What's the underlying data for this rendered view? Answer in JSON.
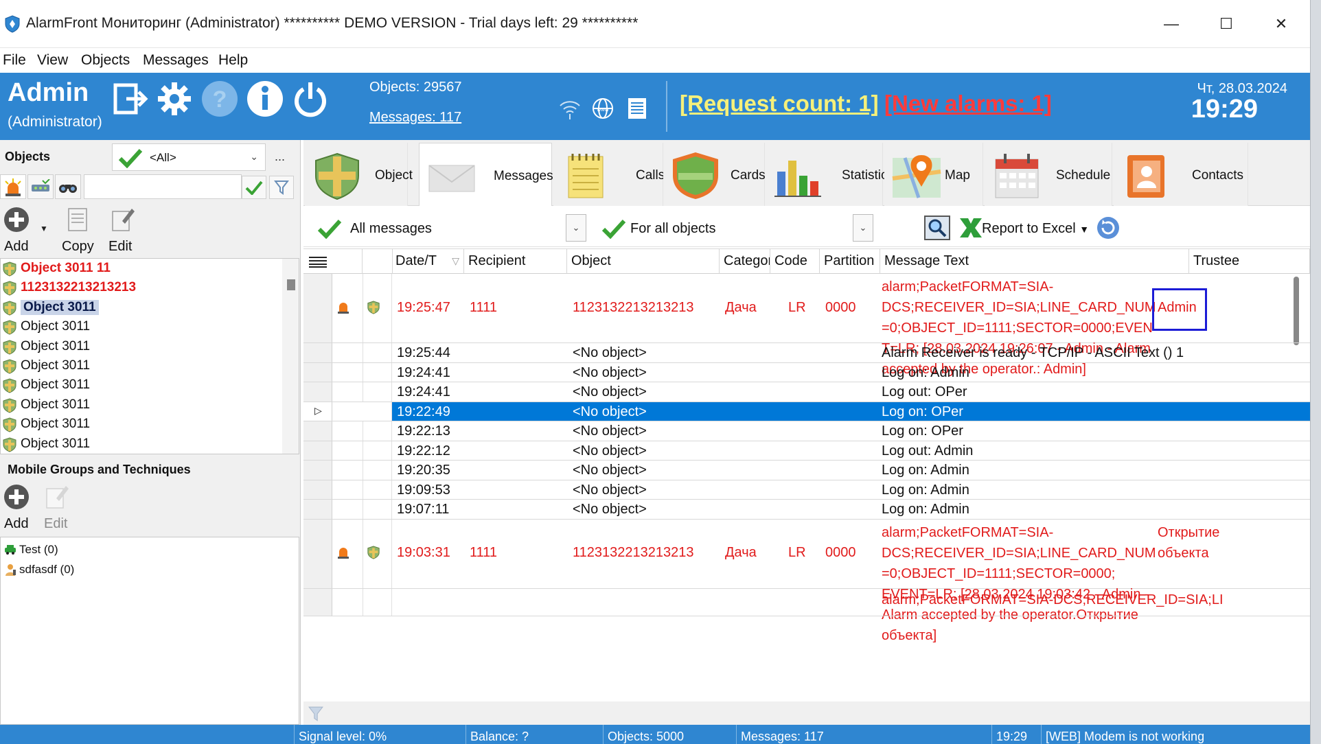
{
  "window": {
    "title": "AlarmFront Мониторинг (Administrator) ********** DEMO VERSION - Trial days left: 29 **********",
    "minimize": "—",
    "maximize": "☐",
    "close": "✕"
  },
  "menu": [
    "File",
    "View",
    "Objects",
    "Messages",
    "Help"
  ],
  "header": {
    "user_name": "Admin",
    "user_role": "(Administrator)",
    "objects_stat": "Objects: 29567",
    "messages_stat": "Messages: 117",
    "request_count": "[Request count: 1]",
    "new_alarms": "[New alarms: 1]",
    "date": "Чт, 28.03.2024",
    "time": "19:29",
    "icons": [
      "exit-icon",
      "gear-icon",
      "help-icon",
      "info-icon",
      "power-icon",
      "wifi-icon",
      "network-icon",
      "document-icon"
    ]
  },
  "left": {
    "objects_title": "Objects",
    "filter_value": "<All>",
    "ellipsis": "...",
    "toolbar": {
      "add": "Add",
      "copy": "Copy",
      "edit": "Edit"
    },
    "objects": [
      {
        "label": "Object 3011 11",
        "state": "alarm"
      },
      {
        "label": "1123132213213213",
        "state": "alarm"
      },
      {
        "label": "Object 3011",
        "state": "selected"
      },
      {
        "label": "Object 3011",
        "state": "normal"
      },
      {
        "label": "Object 3011",
        "state": "normal"
      },
      {
        "label": "Object 3011",
        "state": "normal"
      },
      {
        "label": "Object 3011",
        "state": "normal"
      },
      {
        "label": "Object 3011",
        "state": "normal"
      },
      {
        "label": "Object 3011",
        "state": "normal"
      },
      {
        "label": "Object 3011",
        "state": "normal"
      }
    ],
    "groups_title": "Mobile Groups and Techniques",
    "groups_toolbar": {
      "add": "Add",
      "edit": "Edit"
    },
    "groups": [
      {
        "label": "Test (0)",
        "icon": "car-icon"
      },
      {
        "label": "sdfasdf (0)",
        "icon": "person-icon"
      }
    ]
  },
  "tabs": [
    {
      "label": "Object",
      "icon": "shield-tab-icon"
    },
    {
      "label": "Messages",
      "icon": "envelope-icon"
    },
    {
      "label": "Calls",
      "icon": "notepad-icon"
    },
    {
      "label": "Cards",
      "icon": "shield-card-icon"
    },
    {
      "label": "Statistics",
      "icon": "bar-chart-icon"
    },
    {
      "label": "Map",
      "icon": "map-pin-icon"
    },
    {
      "label": "Schedule",
      "icon": "calendar-icon"
    },
    {
      "label": "Contacts",
      "icon": "contact-book-icon"
    }
  ],
  "filters": {
    "messages": "All messages",
    "objects": "For all objects",
    "report": "Report to Excel"
  },
  "grid": {
    "columns": [
      "Date/T",
      "Recipient",
      "Object",
      "Category",
      "Code",
      "Partition",
      "Message Text",
      "Trustee"
    ],
    "rows": [
      {
        "time": "19:25:47",
        "recipient": "1111",
        "object": "1123132213213213",
        "category": "Дача",
        "code": "LR",
        "partition": "0000",
        "text": "alarm;PacketFORMAT=SIA-DCS;RECEIVER_ID=SIA;LINE_CARD_NUM=0;OBJECT_ID=1111;SECTOR=0000;EVENT=LR;  [28.03.2024 19:26:07 - Admin - Alarm accepted by the operator.: Admin]",
        "trustee": "Admin",
        "kind": "alarm"
      },
      {
        "time": "19:25:44",
        "recipient": "",
        "object": "<No object>",
        "category": "",
        "code": "",
        "partition": "",
        "text": "Alarm Receiver is ready - TCP/IP - ASCII Text () 1",
        "trustee": "",
        "kind": "normal"
      },
      {
        "time": "19:24:41",
        "recipient": "",
        "object": "<No object>",
        "category": "",
        "code": "",
        "partition": "",
        "text": "Log on: Admin",
        "trustee": "",
        "kind": "normal"
      },
      {
        "time": "19:24:41",
        "recipient": "",
        "object": "<No object>",
        "category": "",
        "code": "",
        "partition": "",
        "text": "Log out: OPer",
        "trustee": "",
        "kind": "normal"
      },
      {
        "time": "19:22:49",
        "recipient": "",
        "object": "<No object>",
        "category": "",
        "code": "",
        "partition": "",
        "text": "Log on: OPer",
        "trustee": "",
        "kind": "selected"
      },
      {
        "time": "19:22:13",
        "recipient": "",
        "object": "<No object>",
        "category": "",
        "code": "",
        "partition": "",
        "text": "Log on: OPer",
        "trustee": "",
        "kind": "normal"
      },
      {
        "time": "19:22:12",
        "recipient": "",
        "object": "<No object>",
        "category": "",
        "code": "",
        "partition": "",
        "text": "Log out: Admin",
        "trustee": "",
        "kind": "normal"
      },
      {
        "time": "19:20:35",
        "recipient": "",
        "object": "<No object>",
        "category": "",
        "code": "",
        "partition": "",
        "text": "Log on: Admin",
        "trustee": "",
        "kind": "normal"
      },
      {
        "time": "19:09:53",
        "recipient": "",
        "object": "<No object>",
        "category": "",
        "code": "",
        "partition": "",
        "text": "Log on: Admin",
        "trustee": "",
        "kind": "normal"
      },
      {
        "time": "19:07:11",
        "recipient": "",
        "object": "<No object>",
        "category": "",
        "code": "",
        "partition": "",
        "text": "Log on: Admin",
        "trustee": "",
        "kind": "normal"
      },
      {
        "time": "19:03:31",
        "recipient": "1111",
        "object": "1123132213213213",
        "category": "Дача",
        "code": "LR",
        "partition": "0000",
        "text": "alarm;PacketFORMAT=SIA-DCS;RECEIVER_ID=SIA;LINE_CARD_NUM=0;OBJECT_ID=1111;SECTOR=0000;  EVENT=LR;  [28.03.2024 19:03:42 - Admin - Alarm accepted by the operator.Открытие объекта]",
        "trustee": "Открытие объекта",
        "kind": "alarm"
      },
      {
        "time": "",
        "recipient": "",
        "object": "",
        "category": "",
        "code": "",
        "partition": "",
        "text": "alarm;PacketFORMAT=SIA-DCS;RECEIVER_ID=SIA;LI",
        "trustee": "",
        "kind": "alarm-partial"
      }
    ]
  },
  "statusbar": [
    "Signal level: 0%",
    "Balance: ?",
    "Objects: 5000",
    "Messages: 117",
    "19:29",
    "[WEB] Modem is not working"
  ],
  "colors": {
    "header_blue": "#2f86d1",
    "alarm_red": "#e11b1b",
    "selection_blue": "#0078d7",
    "request_yellow": "#f6f07a"
  }
}
